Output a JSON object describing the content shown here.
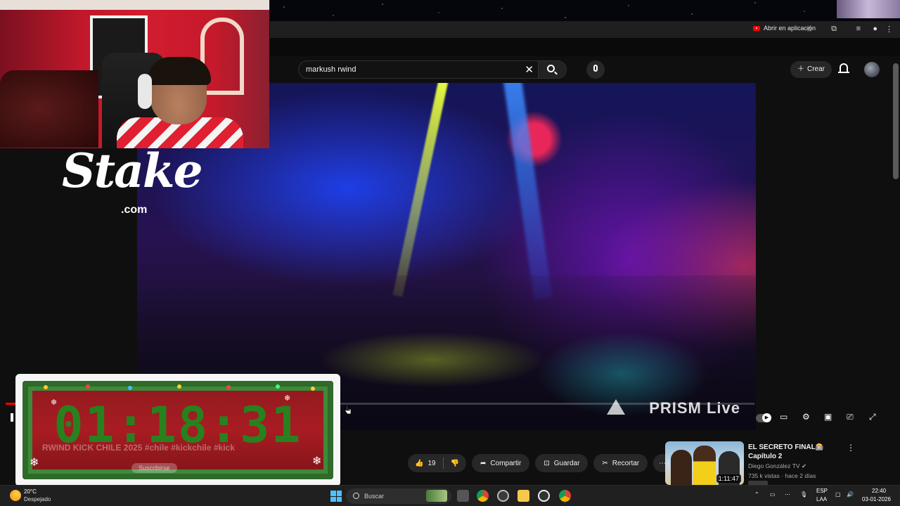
{
  "browser": {
    "open_in_app_label": "Abrir en aplicación"
  },
  "header": {
    "search_query": "markush rwind",
    "create_label": "Crear"
  },
  "video": {
    "watermark": "PRISM Live",
    "progress_fraction": 0.016
  },
  "overlays": {
    "sponsor_logo_text": "Stake",
    "sponsor_logo_suffix": ".com",
    "countdown": "01:18:31",
    "ghost_title": "RWIND KICK CHILE 2025 #chile #kickchile #kick",
    "ghost_subscribe": "Suscribirse"
  },
  "actions": {
    "like_count": "19",
    "share_label": "Compartir",
    "save_label": "Guardar",
    "clip_label": "Recortar"
  },
  "recommended": {
    "title": "EL SECRETO FINAL🎰 Capítulo 2",
    "channel": "Diego González TV",
    "meta": "735 k vistas · hace 2 días",
    "duration": "1:11:47"
  },
  "taskbar": {
    "temperature": "20°C",
    "weather": "Despejado",
    "search_placeholder": "Buscar",
    "lang_top": "ESP",
    "lang_bottom": "LAA",
    "time": "22:40",
    "date": "03-01-2026"
  },
  "colors": {
    "accent_red": "#ff0000",
    "timer_green": "#1e8a1e",
    "windows_blue": "#4cc2ff"
  }
}
